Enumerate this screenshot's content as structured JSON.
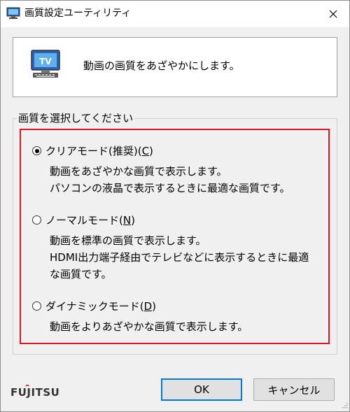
{
  "window": {
    "title": "画質設定ユーティリティ"
  },
  "banner": {
    "text": "動画の画質をあざやかにします。",
    "icon_label": "TV"
  },
  "group": {
    "label": "画質を選択してください"
  },
  "options": [
    {
      "label": "クリアモード(推奨)(C)",
      "label_main": "クリアモード(推奨)(",
      "mnemonic": "C",
      "label_end": ")",
      "checked": true,
      "desc": [
        "動画をあざやかな画質で表示します。",
        "パソコンの液晶で表示するときに最適な画質です。"
      ]
    },
    {
      "label": "ノーマルモード(N)",
      "label_main": "ノーマルモード(",
      "mnemonic": "N",
      "label_end": ")",
      "checked": false,
      "desc": [
        "動画を標準の画質で表示します。",
        "HDMI出力端子経由でテレビなどに表示するときに最適",
        "な画質です。"
      ]
    },
    {
      "label": "ダイナミックモード(D)",
      "label_main": "ダイナミックモード(",
      "mnemonic": "D",
      "label_end": ")",
      "checked": false,
      "desc": [
        "動画をよりあざやかな画質で表示します。"
      ]
    }
  ],
  "footer": {
    "brand": "FUJITSU"
  },
  "buttons": {
    "ok": "OK",
    "cancel": "キャンセル"
  },
  "colors": {
    "highlight": "#e0141e",
    "default_button_border": "#0078d7",
    "brand_red": "#e0141e"
  }
}
